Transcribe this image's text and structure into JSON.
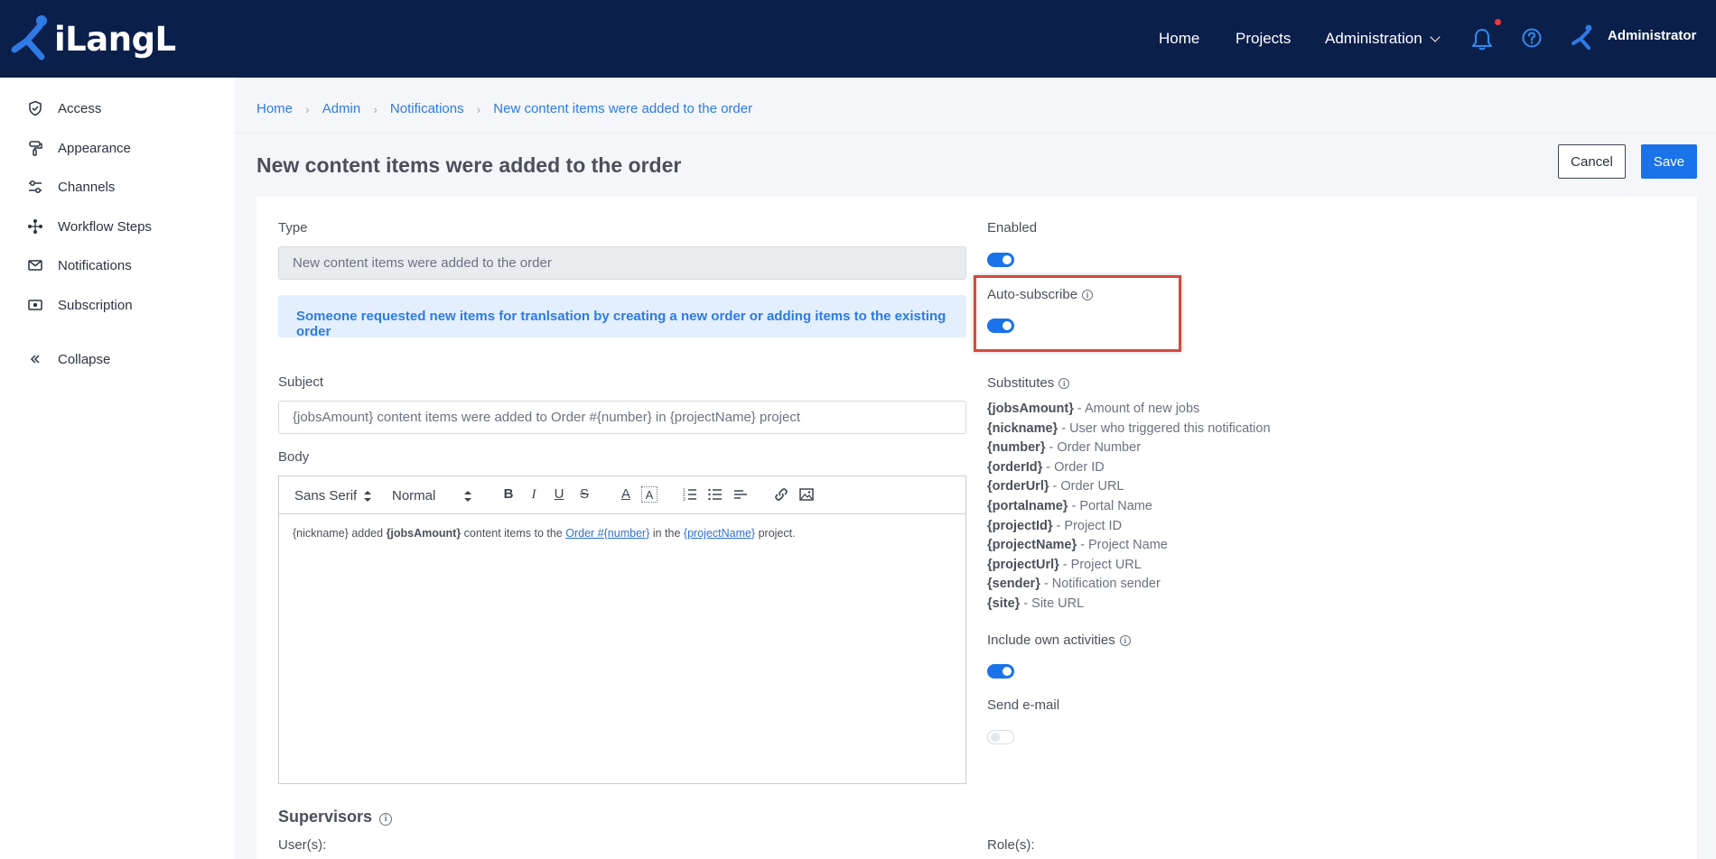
{
  "app": {
    "logo_text": "iLangL"
  },
  "topnav": {
    "home": "Home",
    "projects": "Projects",
    "administration": "Administration",
    "user": "Administrator"
  },
  "sidebar": {
    "items": [
      {
        "label": "Access",
        "icon": "shield-check-icon"
      },
      {
        "label": "Appearance",
        "icon": "paint-roller-icon"
      },
      {
        "label": "Channels",
        "icon": "sliders-icon"
      },
      {
        "label": "Workflow Steps",
        "icon": "workflow-icon"
      },
      {
        "label": "Notifications",
        "icon": "envelope-icon"
      },
      {
        "label": "Subscription",
        "icon": "ticket-icon"
      }
    ],
    "collapse": "Collapse"
  },
  "breadcrumb": [
    "Home",
    "Admin",
    "Notifications",
    "New content items were added to the order"
  ],
  "page": {
    "title": "New content items were added to the order",
    "cancel": "Cancel",
    "save": "Save"
  },
  "form": {
    "type_label": "Type",
    "type_value": "New content items were added to the order",
    "info": "Someone requested new items for tranlsation by creating a new order or adding items to the existing order",
    "subject_label": "Subject",
    "subject_value": "{jobsAmount} content items were added to Order #{number} in {projectName} project",
    "body_label": "Body",
    "editor": {
      "font": "Sans Serif",
      "size": "Normal",
      "body": {
        "p1": "{nickname} added ",
        "b1": "{jobsAmount}",
        "p2": " content items to the ",
        "link1": "Order #{number}",
        "p3": " in the ",
        "link2": "{projectName}",
        "p4": " project."
      }
    },
    "enabled_label": "Enabled",
    "enabled": true,
    "auto_subscribe_label": "Auto-subscribe",
    "auto_subscribe": true,
    "substitutes_label": "Substitutes",
    "substitutes": [
      {
        "key": "{jobsAmount}",
        "desc": " - Amount of new jobs"
      },
      {
        "key": "{nickname}",
        "desc": " - User who triggered this notification"
      },
      {
        "key": "{number}",
        "desc": " - Order Number"
      },
      {
        "key": "{orderId}",
        "desc": " - Order ID"
      },
      {
        "key": "{orderUrl}",
        "desc": " - Order URL"
      },
      {
        "key": "{portalname}",
        "desc": " - Portal Name"
      },
      {
        "key": "{projectId}",
        "desc": " - Project ID"
      },
      {
        "key": "{projectName}",
        "desc": " - Project Name"
      },
      {
        "key": "{projectUrl}",
        "desc": " - Project URL"
      },
      {
        "key": "{sender}",
        "desc": " - Notification sender"
      },
      {
        "key": "{site}",
        "desc": " - Site URL"
      }
    ],
    "include_own_label": "Include own activities",
    "include_own": true,
    "send_email_label": "Send e-mail",
    "send_email": false
  },
  "supervisors": {
    "title": "Supervisors",
    "users_label": "User(s):",
    "roles_label": "Role(s):"
  },
  "colors": {
    "topbar": "#0b1f4b",
    "accent": "#1a73e8",
    "highlight": "#d64a3c"
  }
}
